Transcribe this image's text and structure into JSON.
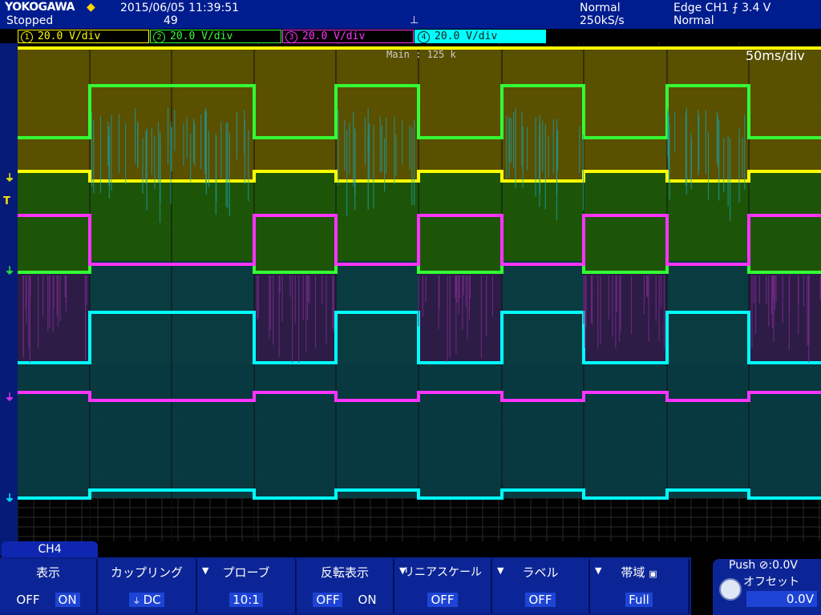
{
  "header": {
    "brand": "YOKOGAWA",
    "status": "Stopped",
    "datetime": "2015/06/05  11:39:51",
    "count": "49",
    "acq_mode": "Normal",
    "sample_rate": "250kS/s",
    "trigger": "Edge CH1 ⨍ 3.4 V",
    "trigger_mode": "Normal"
  },
  "channels": [
    {
      "num": "1",
      "label": "20.0 V/div",
      "color": "#ffff00"
    },
    {
      "num": "2",
      "label": "20.0 V/div",
      "color": "#33ff33"
    },
    {
      "num": "3",
      "label": "20.0 V/div",
      "color": "#ff33ff"
    },
    {
      "num": "4",
      "label": "20.0 V/div",
      "color": "#00ffff"
    }
  ],
  "screen": {
    "record": "Main : 125 k",
    "timebase": "50ms/div"
  },
  "bottom": {
    "channel_tab": "CH4",
    "softkeys": [
      {
        "label": "表示",
        "value_off": "OFF",
        "value_on": "ON"
      },
      {
        "label": "カップリング",
        "value": "DC"
      },
      {
        "label": "プローブ",
        "value": "10:1"
      },
      {
        "label": "反転表示",
        "value_off": "OFF",
        "value_on": "ON"
      },
      {
        "label": "リニアスケール",
        "value": "OFF"
      },
      {
        "label": "ラベル",
        "value": "OFF"
      },
      {
        "label": "帯域",
        "value": "Full"
      }
    ],
    "knob": {
      "push": "Push ⊘:0.0V",
      "label": "オフセット",
      "value": "0.0V"
    }
  }
}
